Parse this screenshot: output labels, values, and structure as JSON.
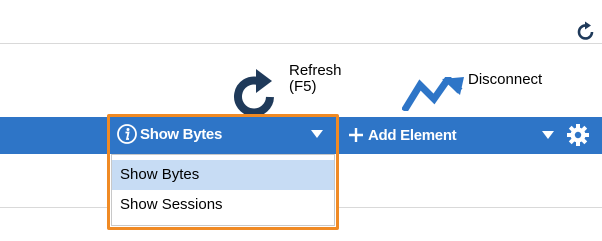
{
  "toolbar": {
    "refresh_label": "Refresh\n(F5)",
    "disconnect_label": "Disconnect"
  },
  "menubar": {
    "selector_label": "Show Bytes",
    "add_element_label": "Add Element"
  },
  "dropdown": {
    "items": [
      {
        "label": "Show Bytes",
        "selected": true
      },
      {
        "label": "Show Sessions",
        "selected": false
      }
    ]
  },
  "colors": {
    "bar": "#2e75c7",
    "highlight_outline": "#f08a24",
    "selected_item": "#c7dcf4"
  },
  "icons": [
    "refresh-icon",
    "disconnect-icon",
    "info-icon",
    "plus-icon",
    "gear-icon",
    "chevron-down-icon"
  ]
}
